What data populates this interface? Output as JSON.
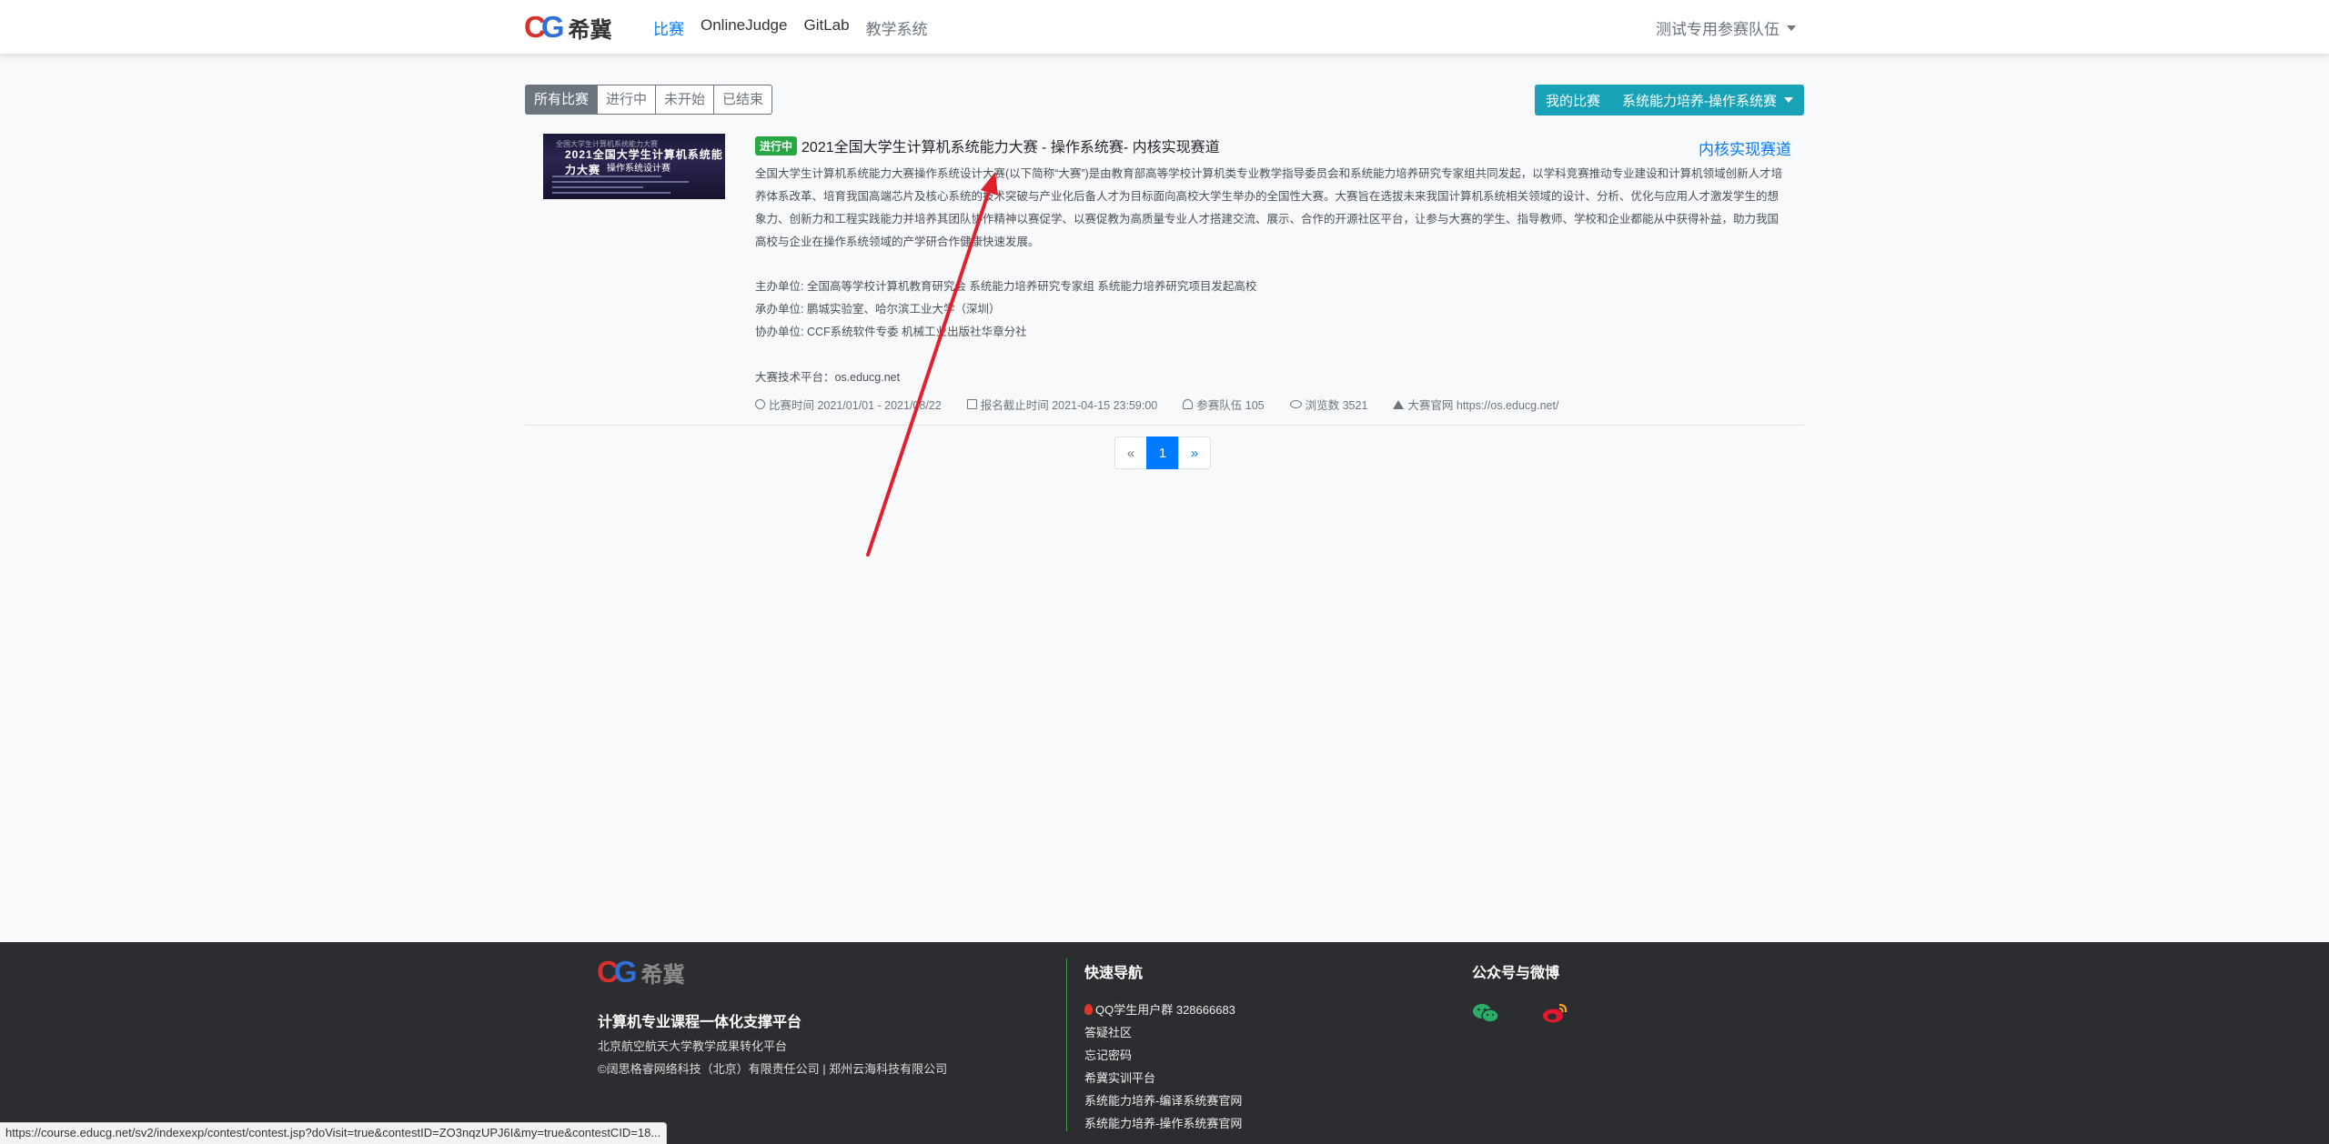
{
  "brand": {
    "c1": "C",
    "c2": "G",
    "name": "希冀"
  },
  "nav": {
    "items": [
      {
        "label": "比赛"
      },
      {
        "label": "OnlineJudge"
      },
      {
        "label": "GitLab"
      },
      {
        "label": "教学系统"
      }
    ],
    "user": "测试专用参赛队伍"
  },
  "filters": [
    "所有比赛",
    "进行中",
    "未开始",
    "已结束"
  ],
  "my_contest": {
    "label": "我的比赛",
    "selected": "系统能力培养-操作系统赛"
  },
  "contest": {
    "thumb": {
      "line1": "全国大学生计算机系统能力大赛",
      "line2": "2021全国大学生计算机系统能力大赛",
      "line3": "操作系统设计赛"
    },
    "status": "进行中",
    "title": "2021全国大学生计算机系统能力大赛 - 操作系统赛- 内核实现赛道",
    "track": "内核实现赛道",
    "description": "全国大学生计算机系统能力大赛操作系统设计大赛(以下简称“大赛”)是由教育部高等学校计算机类专业教学指导委员会和系统能力培养研究专家组共同发起，以学科竞赛推动专业建设和计算机领域创新人才培养体系改革、培育我国高端芯片及核心系统的技术突破与产业化后备人才为目标面向高校大学生举办的全国性大赛。大赛旨在选拔未来我国计算机系统相关领域的设计、分析、优化与应用人才激发学生的想象力、创新力和工程实践能力并培养其团队协作精神以赛促学、以赛促教为高质量专业人才搭建交流、展示、合作的开源社区平台，让参与大赛的学生、指导教师、学校和企业都能从中获得补益，助力我国高校与企业在操作系统领域的产学研合作健康快速发展。",
    "organizer": "主办单位: 全国高等学校计算机教育研究会 系统能力培养研究专家组 系统能力培养研究项目发起高校",
    "host": "承办单位: 鹏城实验室、哈尔滨工业大学（深圳）",
    "co_organizer": "协办单位: CCF系统软件专委 机械工业出版社华章分社",
    "platform": "大赛技术平台：os.educg.net",
    "meta": {
      "time": "比赛时间 2021/01/01 - 2021/08/22",
      "deadline": "报名截止时间 2021-04-15 23:59:00",
      "teams": "参赛队伍 105",
      "views": "浏览数 3521",
      "site": "大赛官网 https://os.educg.net/"
    }
  },
  "pagination": {
    "prev": "«",
    "current": "1",
    "next": "»"
  },
  "footer": {
    "slogan": "计算机专业课程一体化支撑平台",
    "line1": "北京航空航天大学教学成果转化平台",
    "line2": "©阔思格睿网络科技（北京）有限责任公司 | 郑州云海科技有限公司",
    "nav_title": "快速导航",
    "nav_links": [
      "QQ学生用户群 328666683",
      "答疑社区",
      "忘记密码",
      "希冀实训平台",
      "系统能力培养-编译系统赛官网",
      "系统能力培养-操作系统赛官网"
    ],
    "social_title": "公众号与微博"
  },
  "statusbar_url": "https://course.educg.net/sv2/indexexp/contest/contest.jsp?doVisit=true&contestID=ZO3nqzUPJ6I&my=true&contestCID=18...",
  "colors": {
    "primary": "#007bff",
    "info": "#17a2b8",
    "success": "#28a745",
    "annotation": "#e0202a",
    "footer_bg": "#2b2d31"
  }
}
